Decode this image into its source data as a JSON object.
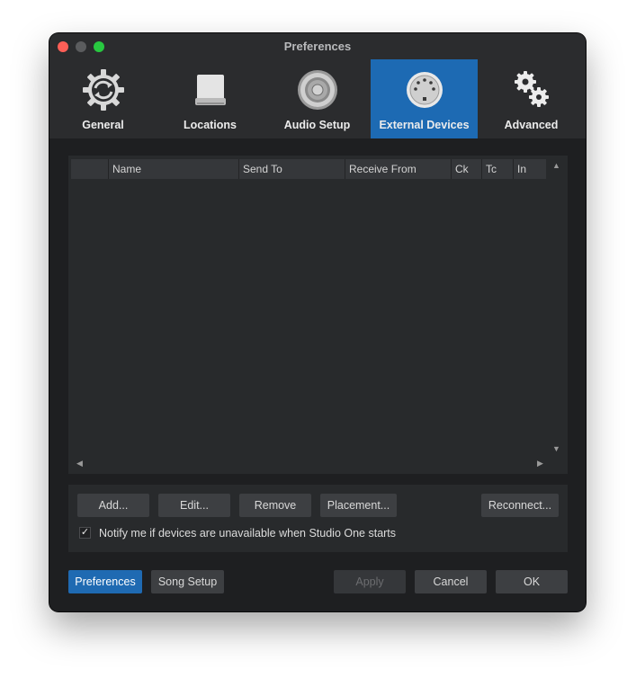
{
  "window": {
    "title": "Preferences"
  },
  "tabs": [
    {
      "label": "General",
      "icon": "gear-refresh-icon"
    },
    {
      "label": "Locations",
      "icon": "drive-icon"
    },
    {
      "label": "Audio Setup",
      "icon": "speaker-icon"
    },
    {
      "label": "External Devices",
      "icon": "midi-connector-icon",
      "active": true
    },
    {
      "label": "Advanced",
      "icon": "gears-icon"
    }
  ],
  "table": {
    "columns": [
      "",
      "Name",
      "Send To",
      "Receive From",
      "Ck",
      "Tc",
      "In"
    ],
    "rows": []
  },
  "actions": {
    "add": "Add...",
    "edit": "Edit...",
    "remove": "Remove",
    "placement": "Placement...",
    "reconnect": "Reconnect..."
  },
  "notify": {
    "label": "Notify me if devices are unavailable when Studio One starts",
    "checked": true
  },
  "footer": {
    "preferences": "Preferences",
    "song_setup": "Song Setup",
    "apply": "Apply",
    "cancel": "Cancel",
    "ok": "OK"
  },
  "colors": {
    "accent": "#1d6ab3",
    "background": "#1e1f21",
    "panel": "#282a2c"
  }
}
